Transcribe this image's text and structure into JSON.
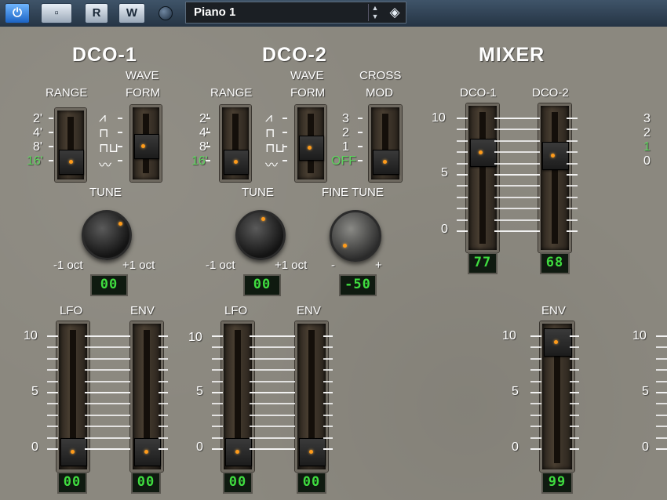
{
  "header": {
    "power_icon": "power-icon",
    "btn_monitor": "▫",
    "btn_read": "R",
    "btn_write": "W",
    "preset_name": "Piano 1"
  },
  "dco1": {
    "title": "DCO-1",
    "range_label": "RANGE",
    "wave_label_1": "WAVE",
    "wave_label_2": "FORM",
    "range_values": [
      "2'",
      "4'",
      "8'",
      "16'"
    ],
    "tune_label": "TUNE",
    "tune_min": "-1 oct",
    "tune_max": "+1 oct",
    "tune_display": "00",
    "lfo_label": "LFO",
    "env_label": "ENV",
    "lfo_display": "00",
    "env_display": "00"
  },
  "dco2": {
    "title": "DCO-2",
    "range_label": "RANGE",
    "wave_label_1": "WAVE",
    "wave_label_2": "FORM",
    "range_values": [
      "2'",
      "4'",
      "8'",
      "16'"
    ],
    "cross_label_1": "CROSS",
    "cross_label_2": "MOD",
    "cross_values": [
      "3",
      "2",
      "1",
      "OFF"
    ],
    "tune_label": "TUNE",
    "tune_min": "-1 oct",
    "tune_max": "+1 oct",
    "tune_display": "00",
    "fine_label": "FINE TUNE",
    "fine_min": "-",
    "fine_max": "+",
    "fine_display": "-50",
    "lfo_label": "LFO",
    "env_label": "ENV",
    "lfo_display": "00",
    "env_display": "00"
  },
  "mixer": {
    "title": "MIXER",
    "dco1_label": "DCO-1",
    "dco2_label": "DCO-2",
    "scale": [
      "10",
      "5",
      "0"
    ],
    "dco1_display": "77",
    "dco2_display": "68",
    "env_label": "ENV",
    "env_display": "99"
  },
  "right_partial": {
    "values": [
      "3",
      "2",
      "1",
      "0"
    ]
  },
  "scale": [
    "10",
    "5",
    "0"
  ]
}
